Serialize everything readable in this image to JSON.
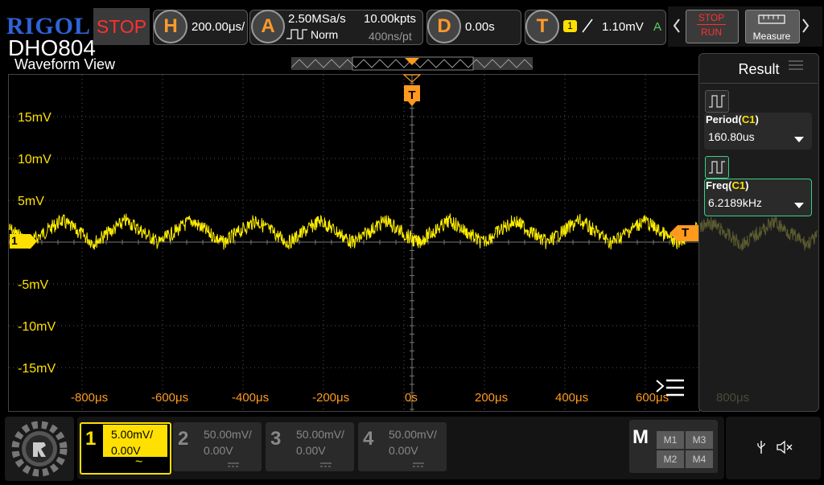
{
  "brand": "RIGOL",
  "model": "DHO804",
  "run_state": "STOP",
  "horizontal": {
    "icon": "H",
    "scale": "200.00μs/"
  },
  "acquire": {
    "icon": "A",
    "sample_rate": "2.50MSa/s",
    "mode": "Norm",
    "points": "10.00kpts",
    "time_per_point": "400ns/pt"
  },
  "delay": {
    "icon": "D",
    "value": "0.00s"
  },
  "trigger": {
    "icon": "T",
    "source": "1",
    "level": "1.10mV",
    "mode": "A"
  },
  "toolbar": {
    "stop_label": "STOP",
    "run_label": "RUN",
    "measure_label": "Measure"
  },
  "waveform": {
    "title": "Waveform View",
    "y_labels": [
      "15mV",
      "10mV",
      "5mV",
      "-5mV",
      "-10mV",
      "-15mV"
    ],
    "x_labels": [
      "-800μs",
      "-600μs",
      "-400μs",
      "-200μs",
      "0s",
      "200μs",
      "400μs",
      "600μs"
    ],
    "ghost_x_label": "800μs",
    "ch1_marker": "1",
    "trigger_marker": "T",
    "trace_color": "#ffee00"
  },
  "result": {
    "title": "Result",
    "items": [
      {
        "name": "Period",
        "src": "C1",
        "value": "160.80us"
      },
      {
        "name": "Freq",
        "src": "C1",
        "value": "6.2189kHz"
      }
    ]
  },
  "channels": [
    {
      "num": "1",
      "scale": "5.00mV/",
      "offset": "0.00V",
      "coupling": "~",
      "active": true,
      "color": "#ffe000"
    },
    {
      "num": "2",
      "scale": "50.00mV/",
      "offset": "0.00V",
      "coupling": "",
      "active": false
    },
    {
      "num": "3",
      "scale": "50.00mV/",
      "offset": "0.00V",
      "coupling": "",
      "active": false
    },
    {
      "num": "4",
      "scale": "50.00mV/",
      "offset": "0.00V",
      "coupling": "",
      "active": false
    }
  ],
  "math": {
    "label": "M",
    "items": [
      "M1",
      "M3",
      "M2",
      "M4"
    ]
  },
  "colors": {
    "accent_orange": "#ff9a1e",
    "ch1_yellow": "#ffe000",
    "stop_red": "#ff3030",
    "brand_blue": "#2e64d8"
  }
}
